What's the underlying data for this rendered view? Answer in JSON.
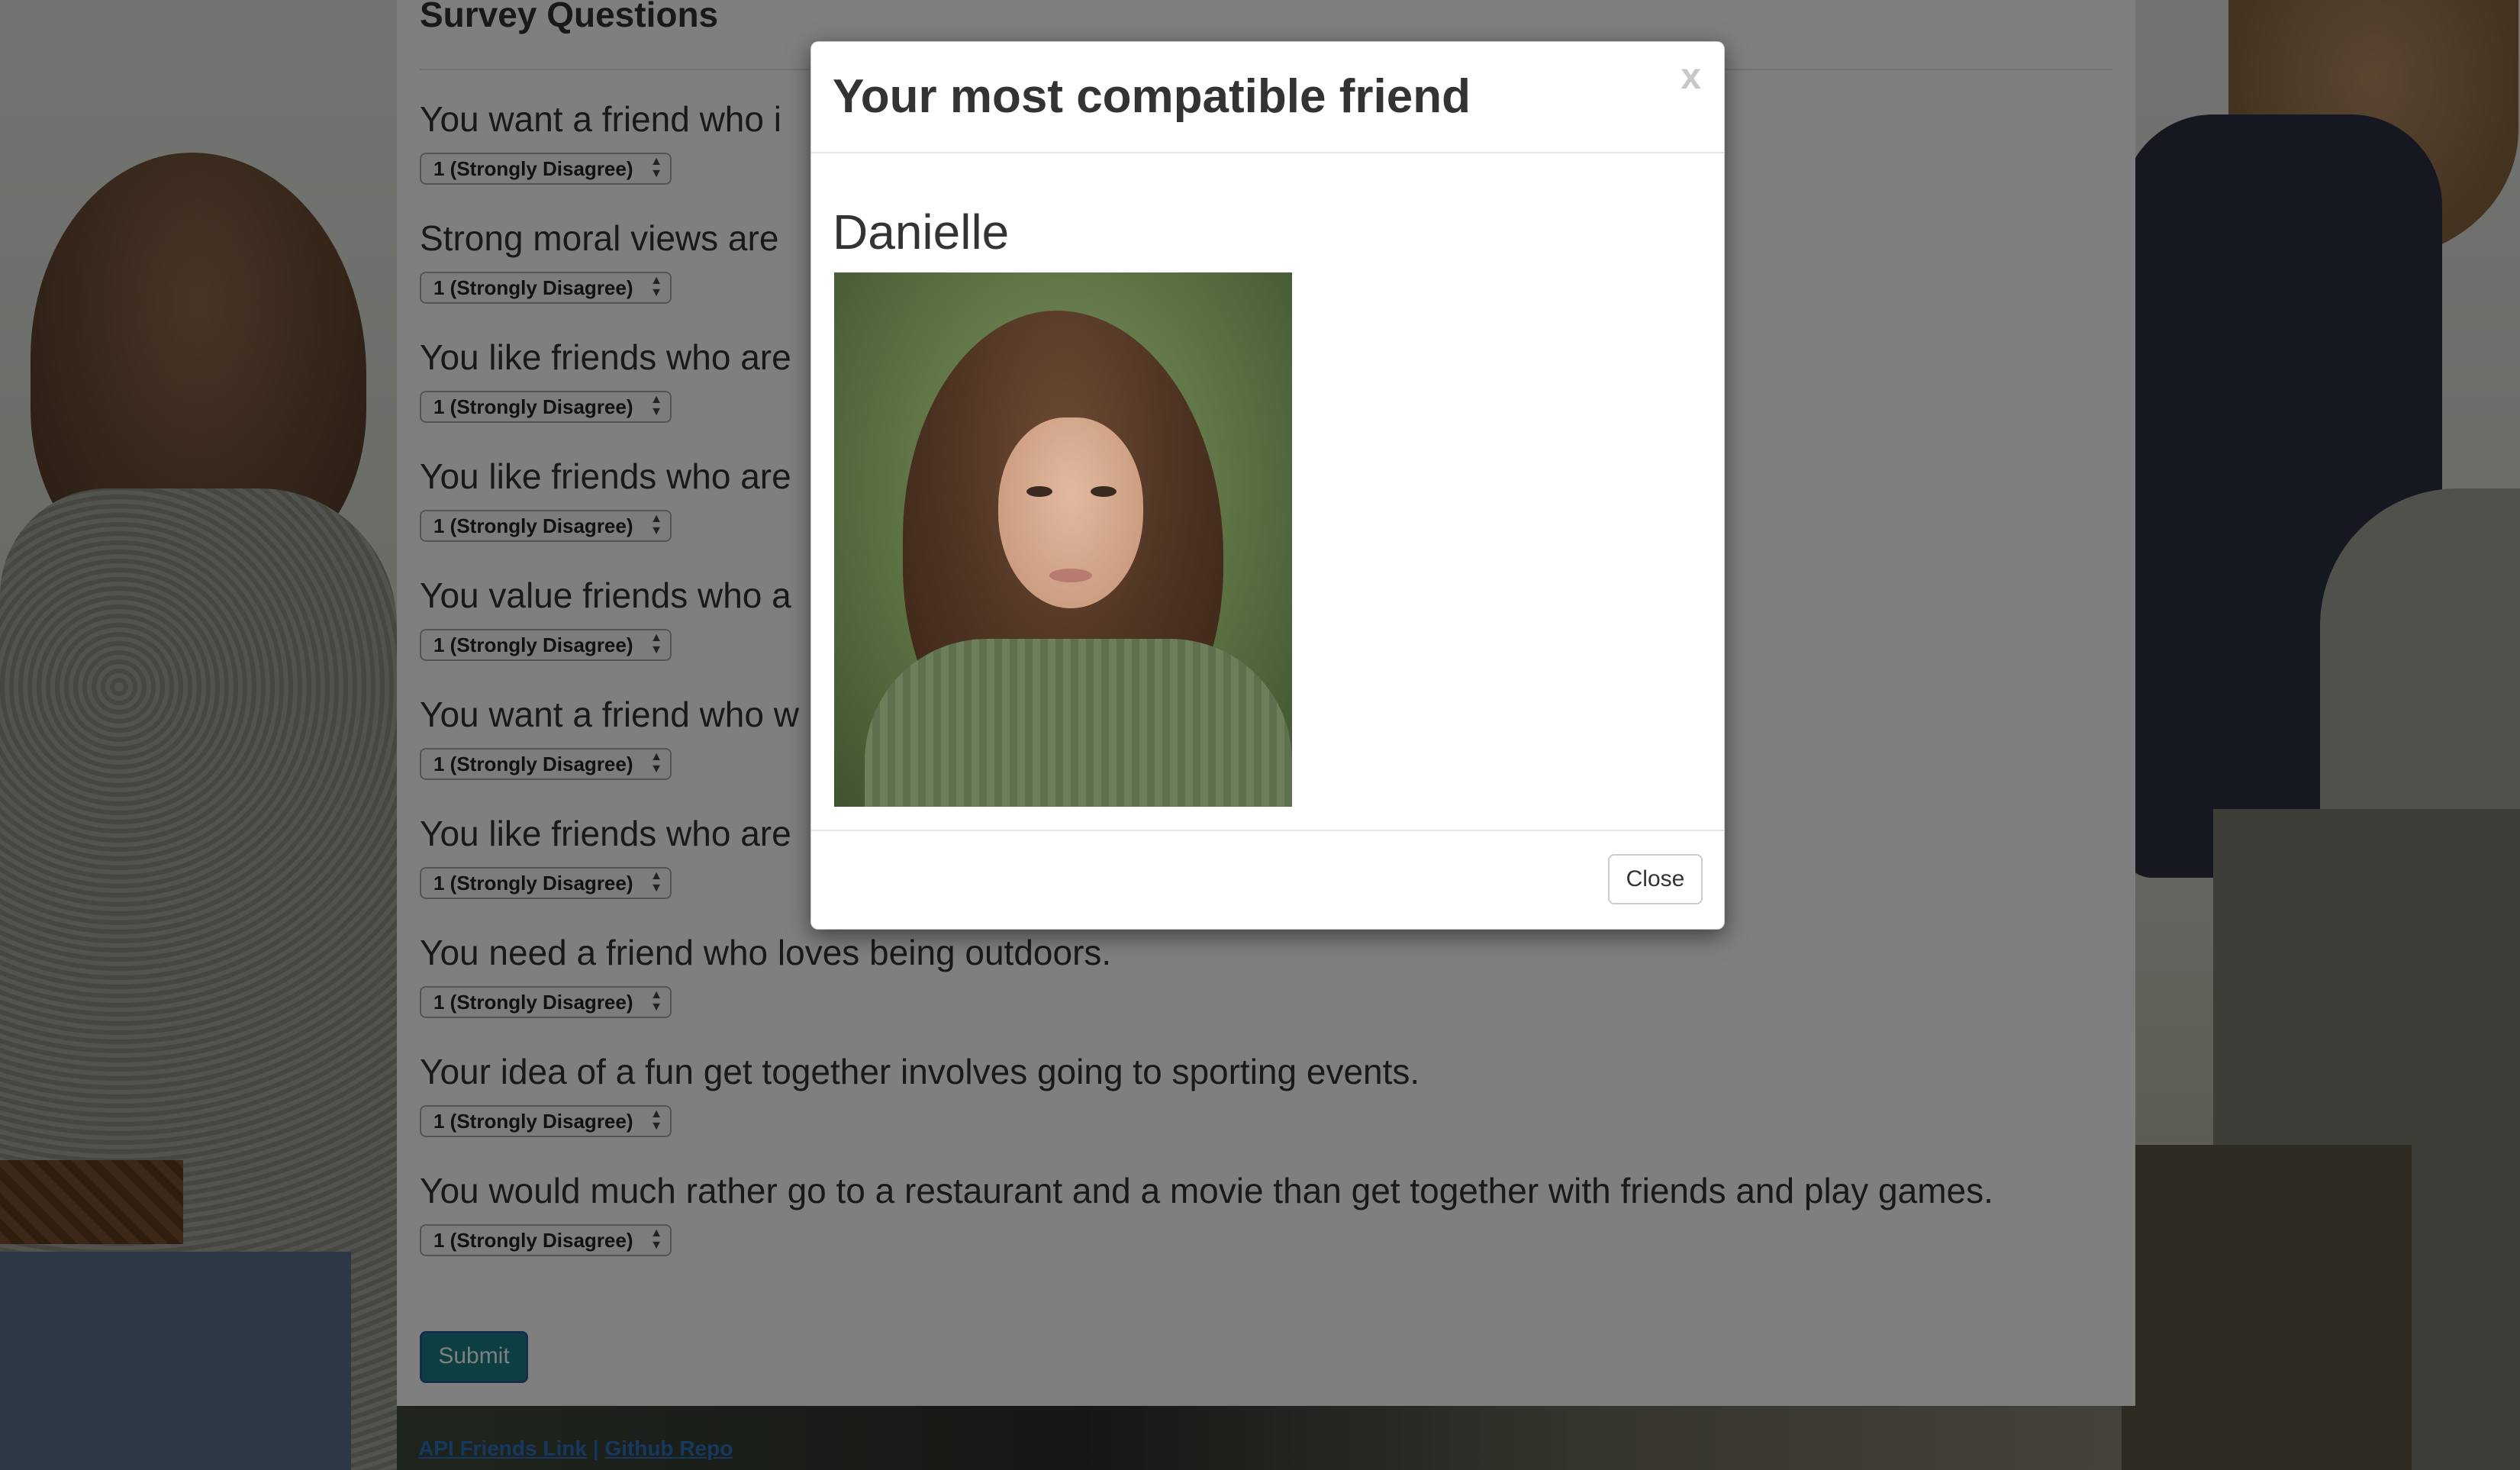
{
  "survey": {
    "title": "Survey Questions",
    "questions": [
      {
        "text": "You want a friend who i",
        "selected": "1 (Strongly Disagree)"
      },
      {
        "text": "Strong moral views are",
        "selected": "1 (Strongly Disagree)"
      },
      {
        "text": "You like friends who are",
        "selected": "1 (Strongly Disagree)"
      },
      {
        "text": "You like friends who are",
        "selected": "1 (Strongly Disagree)"
      },
      {
        "text": "You value friends who a",
        "selected": "1 (Strongly Disagree)"
      },
      {
        "text": "You want a friend who w",
        "selected": "1 (Strongly Disagree)"
      },
      {
        "text": "You like friends who are",
        "selected": "1 (Strongly Disagree)"
      },
      {
        "text": "You need a friend who loves being outdoors.",
        "selected": "1 (Strongly Disagree)"
      },
      {
        "text": "Your idea of a fun get together involves going to sporting events.",
        "selected": "1 (Strongly Disagree)"
      },
      {
        "text": "You would much rather go to a restaurant and a movie than get together with friends and play games.",
        "selected": "1 (Strongly Disagree)"
      }
    ],
    "submit_label": "Submit"
  },
  "footer": {
    "api_link": "API Friends Link",
    "separator": "|",
    "github_link": "Github Repo"
  },
  "modal": {
    "title": "Your most compatible friend",
    "close_x": "x",
    "friend_name": "Danielle",
    "close_label": "Close"
  },
  "colors": {
    "submit_bg": "#1a7f84",
    "link": "#2a6fc0",
    "backdrop": "rgba(0,0,0,0.5)"
  }
}
